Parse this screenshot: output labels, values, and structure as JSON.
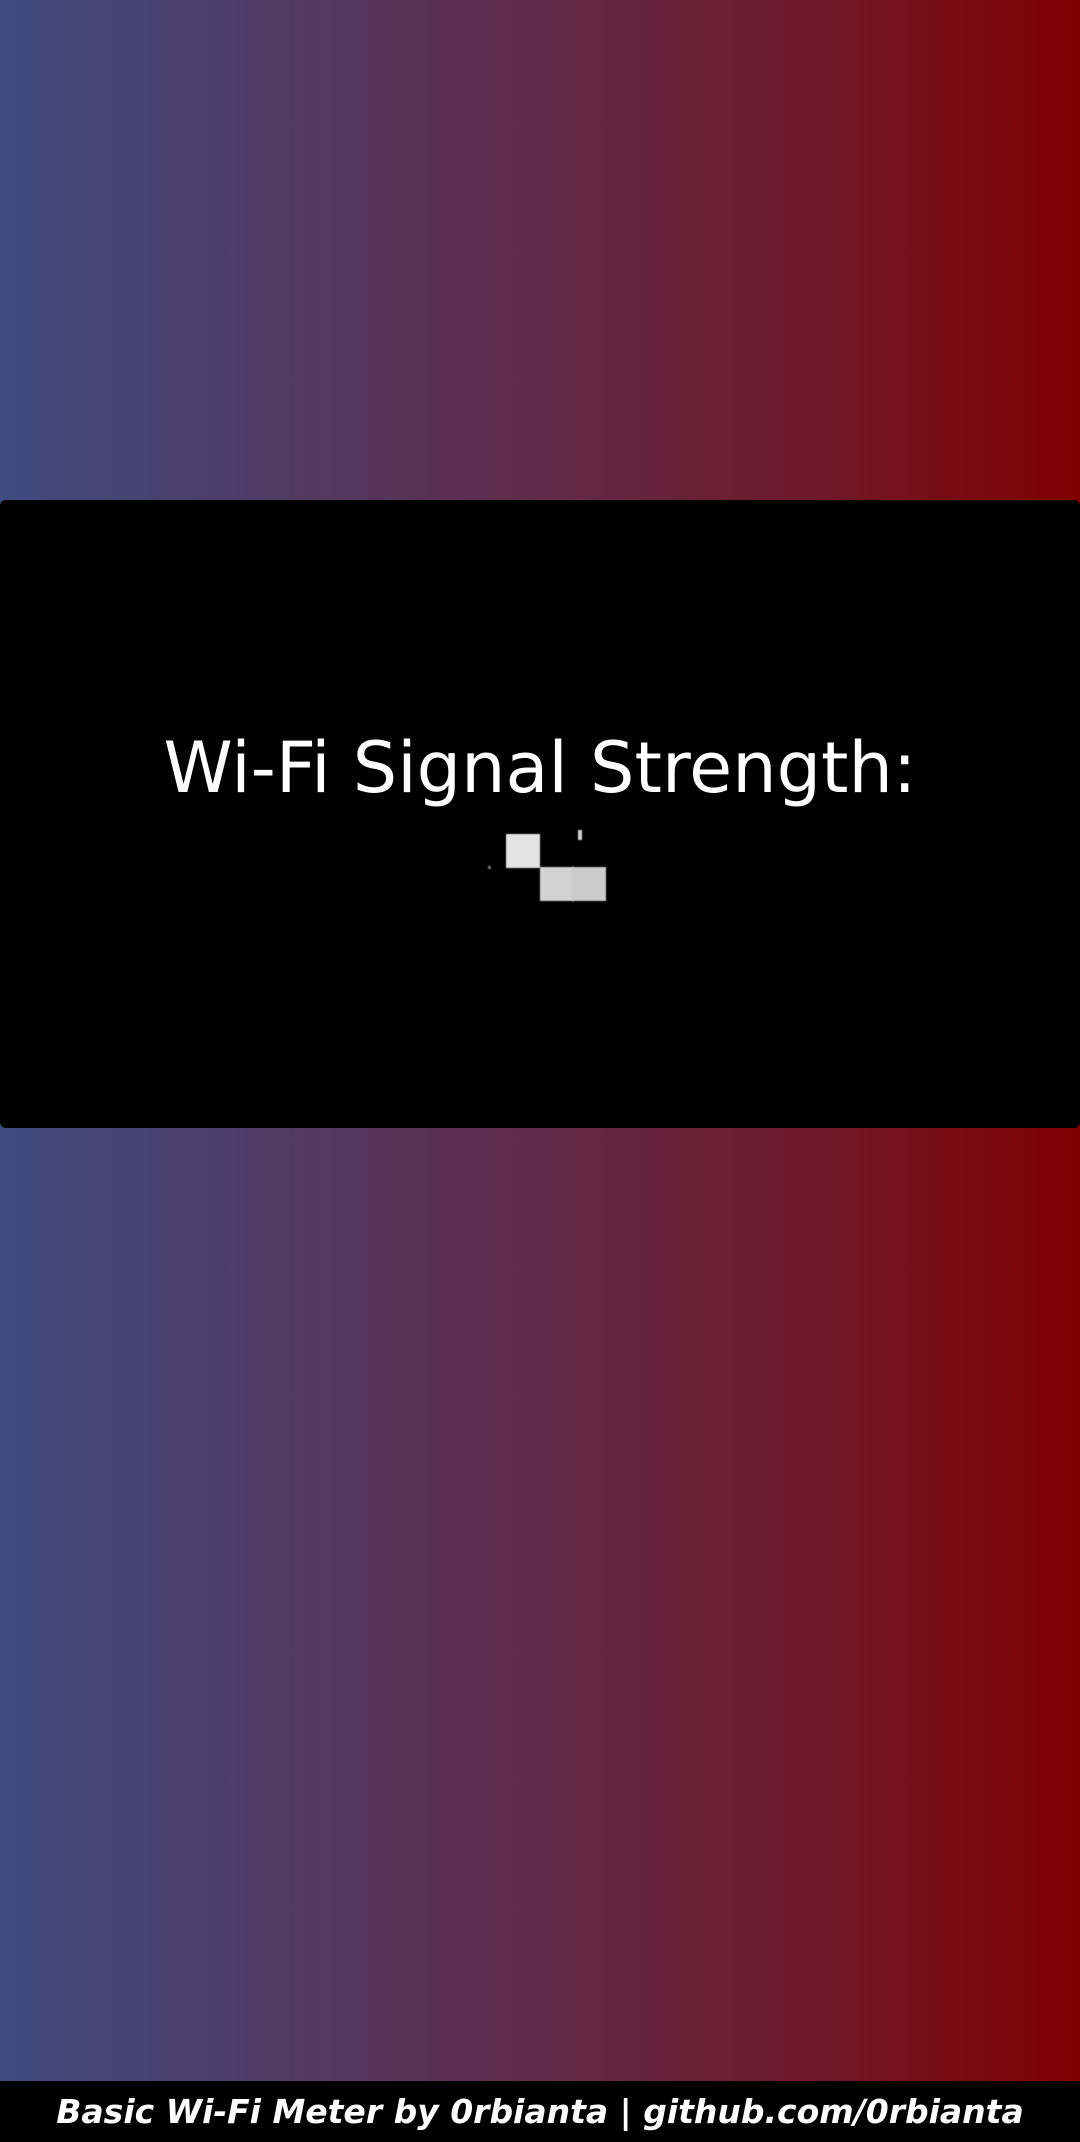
{
  "background": {
    "gradient_start": "#3f4c7f",
    "gradient_end": "#800000"
  },
  "panel": {
    "title": "Wi-Fi Signal Strength:",
    "signal_icon": "signal-strength-icon",
    "background_color": "#000000"
  },
  "footer": {
    "text": "Basic Wi-Fi Meter by 0rbianta | github.com/0rbianta"
  }
}
